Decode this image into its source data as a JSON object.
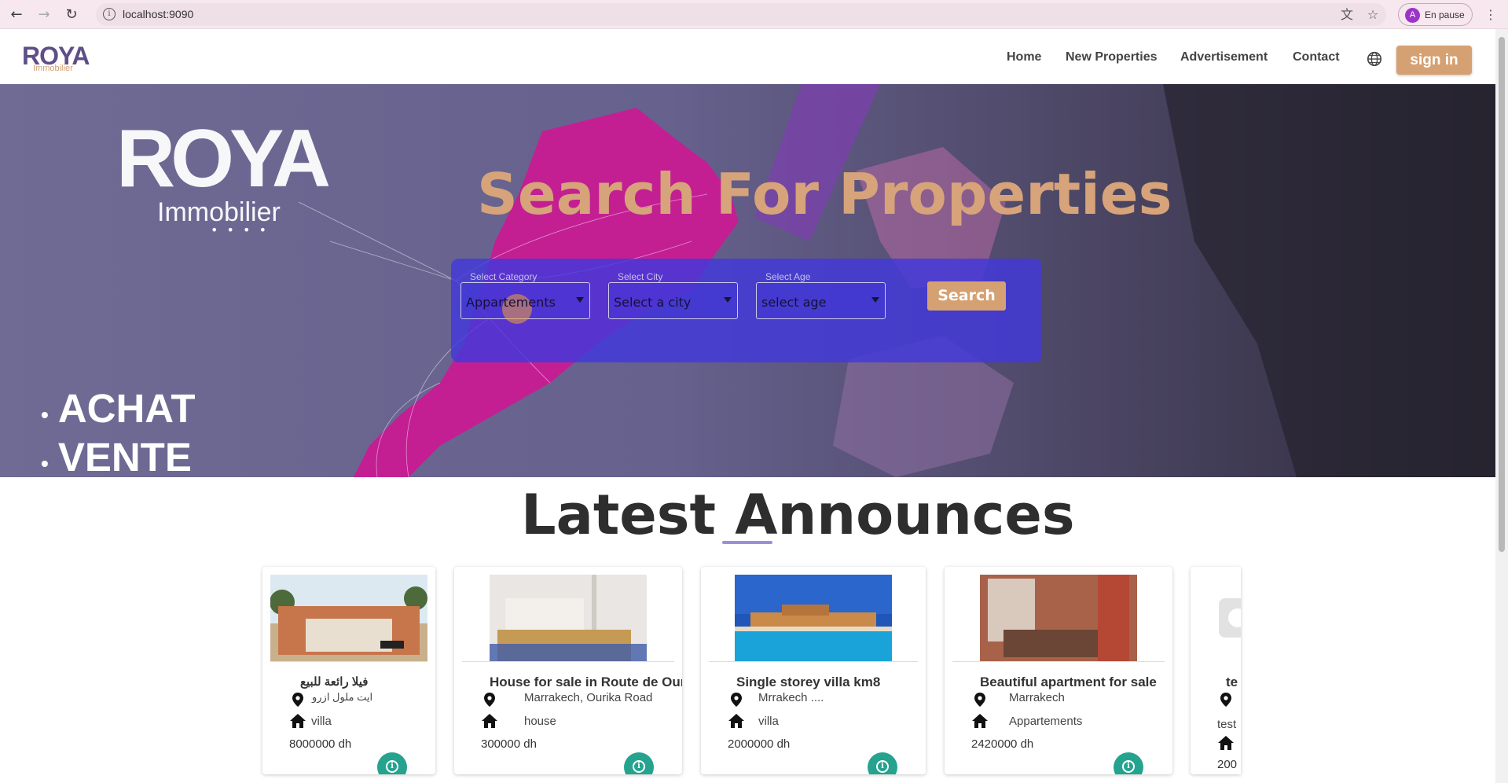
{
  "browser": {
    "url": "localhost:9090",
    "profile_initial": "A",
    "profile_label": "En pause"
  },
  "header": {
    "logo_text": "ROYA",
    "logo_sub": "Immobilier",
    "nav": [
      "Home",
      "New Properties",
      "Advertisement",
      "Contact"
    ],
    "signin_label": "sign in"
  },
  "hero": {
    "brand_title": "ROYA",
    "brand_sub": "Immobilier",
    "brand_dots": "• • • •",
    "left_words": [
      "ACHAT",
      "VENTE"
    ],
    "title": "Search For Properties",
    "filters": [
      {
        "label": "Select Category",
        "value": "Appartements"
      },
      {
        "label": "Select City",
        "value": "Select a city"
      },
      {
        "label": "Select Age",
        "value": "select age"
      }
    ],
    "search_label": "Search"
  },
  "announces": {
    "title": "Latest Announces",
    "cards": [
      {
        "title": "فيلا رائعة للبيع",
        "location": "ايت ملول ازرو",
        "type": "villa",
        "price": "8000000 dh"
      },
      {
        "title": "House for sale in Route de Ourika",
        "location": "Marrakech, Ourika Road",
        "type": "house",
        "price": "300000 dh"
      },
      {
        "title": "Single storey villa km8",
        "location": "Mrrakech ....",
        "type": "villa",
        "price": "2000000 dh"
      },
      {
        "title": "Beautiful apartment for sale",
        "location": "Marrakech",
        "type": "Appartements",
        "price": "2420000 dh"
      },
      {
        "title": "te",
        "location": "",
        "type": "test",
        "price": "200"
      }
    ]
  },
  "colors": {
    "accent": "#d5a173",
    "brand": "#5d4f87",
    "panel": "#4238dc",
    "info": "#25a38f"
  }
}
